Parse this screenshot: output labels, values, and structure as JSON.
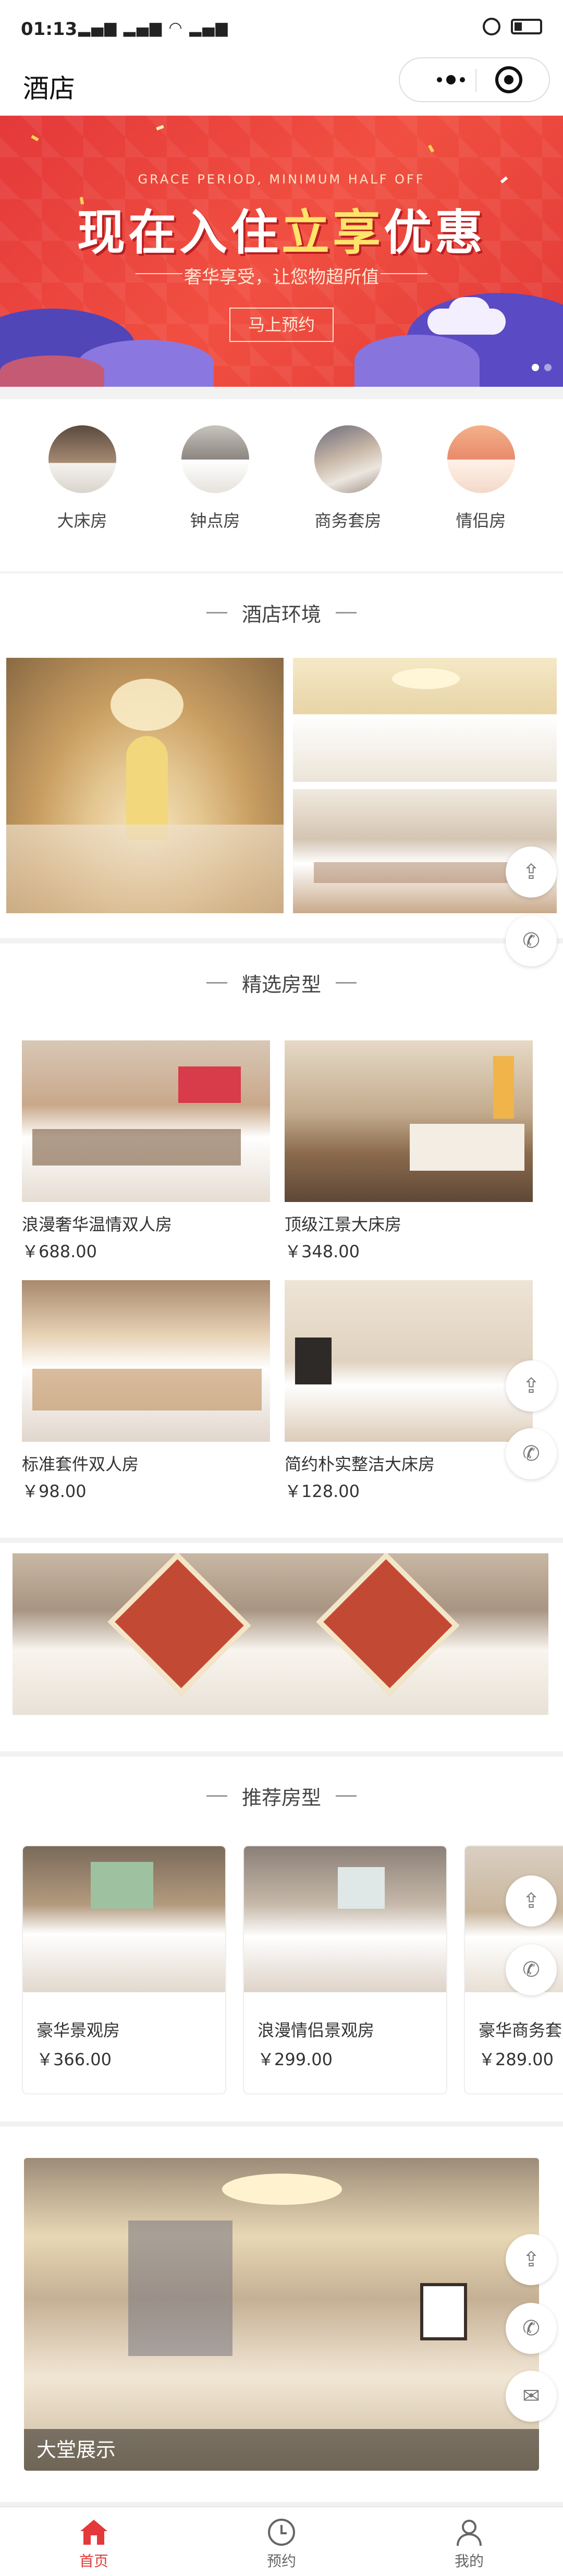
{
  "status_bar": {
    "time": "01:13",
    "signal_text": "▂▄▆ ▂▄▆ ◠ ▂▄▆"
  },
  "nav": {
    "title": "酒店"
  },
  "banner": {
    "sub_en": "GRACE PERIOD, MINIMUM HALF OFF",
    "title_part1": "现在入住",
    "title_highlight": "立享",
    "title_part2": "优惠",
    "slogan": "奢华享受，让您物超所值",
    "button": "马上预约",
    "active_dot": 1,
    "colors": {
      "bg": "#e4393a",
      "accent": "#ffe46a",
      "mountain": "#6f5fd2"
    }
  },
  "categories": [
    {
      "label": "大床房",
      "icon": "room-icon"
    },
    {
      "label": "钟点房",
      "icon": "bathtub-icon"
    },
    {
      "label": "商务套房",
      "icon": "suite-icon"
    },
    {
      "label": "情侣房",
      "icon": "couple-room-icon"
    }
  ],
  "environment": {
    "title": "酒店环境"
  },
  "selected": {
    "title": "精选房型",
    "rooms": [
      {
        "name": "浪漫奢华温情双人房",
        "price": "￥688.00"
      },
      {
        "name": "顶级江景大床房",
        "price": "￥348.00"
      },
      {
        "name": "标准套件双人房",
        "price": "￥98.00"
      },
      {
        "name": "简约朴实整洁大床房",
        "price": "￥128.00"
      }
    ]
  },
  "recommend": {
    "title": "推荐房型",
    "rooms": [
      {
        "name": "豪华景观房",
        "price": "￥366.00"
      },
      {
        "name": "浪漫情侣景观房",
        "price": "￥299.00"
      },
      {
        "name": "豪华商务套",
        "price": "￥289.00"
      }
    ]
  },
  "lobby": {
    "caption": "大堂展示"
  },
  "tabs": [
    {
      "label": "首页",
      "icon": "home-icon",
      "active": true
    },
    {
      "label": "预约",
      "icon": "clock-icon",
      "active": false
    },
    {
      "label": "我的",
      "icon": "user-icon",
      "active": false
    }
  ],
  "colors": {
    "accent": "#e4393a",
    "background": "#f2f2f2"
  }
}
